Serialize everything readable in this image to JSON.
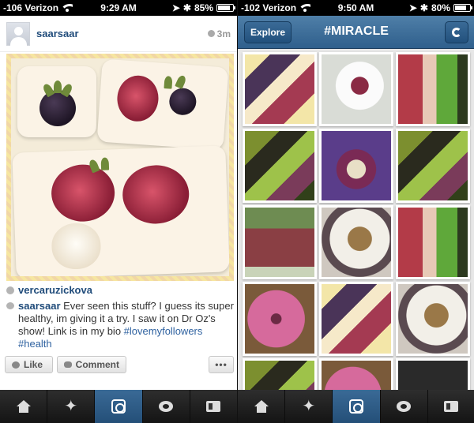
{
  "left": {
    "status": {
      "carrier": "-106 Verizon",
      "time": "9:29 AM",
      "battery": "85%",
      "battery_level": 0.85
    },
    "post": {
      "username": "saarsaar",
      "time_ago": "3m",
      "liker": "vercaruzickova",
      "caption_user": "saarsaar",
      "caption_text": " Ever seen this stuff? I guess its super healthy, im giving it a try. I saw it on Dr Oz's show! Link is in my bio ",
      "hashtag_1": "#lovemyfollowers",
      "hashtag_2": "#health",
      "like_label": "Like",
      "comment_label": "Comment",
      "more_label": "•••"
    },
    "tabs": [
      "home",
      "explore",
      "camera",
      "news",
      "profile"
    ],
    "active_tab": "camera"
  },
  "right": {
    "status": {
      "carrier": "-102 Verizon",
      "time": "9:50 AM",
      "battery": "80%",
      "battery_level": 0.8
    },
    "nav": {
      "back_label": "Explore",
      "title": "#MIRACLE"
    },
    "tiles": [
      {
        "kind": "collage"
      },
      {
        "kind": "plate"
      },
      {
        "kind": "drinks"
      },
      {
        "kind": "plants"
      },
      {
        "kind": "purple"
      },
      {
        "kind": "plants"
      },
      {
        "kind": "smoothie"
      },
      {
        "kind": "cup"
      },
      {
        "kind": "drinks"
      },
      {
        "kind": "pink-fruit"
      },
      {
        "kind": "collage"
      },
      {
        "kind": "cup"
      },
      {
        "kind": "plants"
      },
      {
        "kind": "pink-fruit"
      },
      {
        "kind": "flower"
      }
    ],
    "tabs": [
      "home",
      "explore",
      "camera",
      "news",
      "profile"
    ],
    "active_tab": "camera"
  },
  "colors": {
    "nav_blue": "#3a6a96",
    "link_blue": "#1f4b7a",
    "hashtag_blue": "#2f62a0"
  }
}
